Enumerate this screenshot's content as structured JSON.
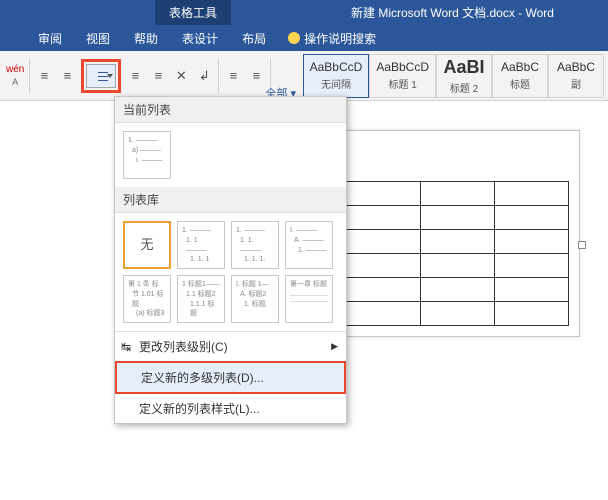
{
  "titlebar": {
    "tools_tab": "表格工具",
    "doc_title": "新建 Microsoft Word 文档.docx - Word"
  },
  "tabs": {
    "items": [
      "审阅",
      "视图",
      "帮助",
      "表设计",
      "布局"
    ],
    "active_index": 3,
    "tell_me": "操作说明搜索"
  },
  "ribbon": {
    "wen_label": "wén",
    "a_label": "A",
    "all_label": "全部 ▾"
  },
  "styles": [
    {
      "sample": "AaBbCcD",
      "name": "无间隔",
      "selected": true
    },
    {
      "sample": "AaBbCcD",
      "name": "标题 1"
    },
    {
      "sample": "AaBI",
      "name": "标题 2",
      "big": true
    },
    {
      "sample": "AaBbC",
      "name": "标题"
    },
    {
      "sample": "AaBbC",
      "name": "副"
    }
  ],
  "dropdown": {
    "current_header": "当前列表",
    "library_header": "列表库",
    "none_label": "无",
    "current_thumb": {
      "l1": "1. ———",
      "l2": "a) ———",
      "l3": "i. ———"
    },
    "thumbs": [
      {
        "l1": "1. ———",
        "l2": "1. 1 ———",
        "l3": "1. 1. 1 ——"
      },
      {
        "l1": "1. ———",
        "l2": "1. 1. ———",
        "l3": "1. 1. 1. ——"
      },
      {
        "l1": "I. ———",
        "l2": "A. ———",
        "l3": "1. ———"
      },
      {
        "l1": "第 1 条 标",
        "l2": "节 1.01 标题",
        "l3": "(a) 标题3"
      },
      {
        "l1": "1 标题1——",
        "l2": "1.1 标题2",
        "l3": "1.1.1 标题"
      },
      {
        "l1": "I. 标题 1—",
        "l2": "A. 标题2",
        "l3": "1. 标题"
      },
      {
        "l1": "第一章 标题",
        "l2": "———",
        "l3": "———"
      }
    ],
    "menu": {
      "change_level": "更改列表级别(C)",
      "define_new_multilevel": "定义新的多级列表(D)...",
      "define_new_style": "定义新的列表样式(L)..."
    }
  }
}
